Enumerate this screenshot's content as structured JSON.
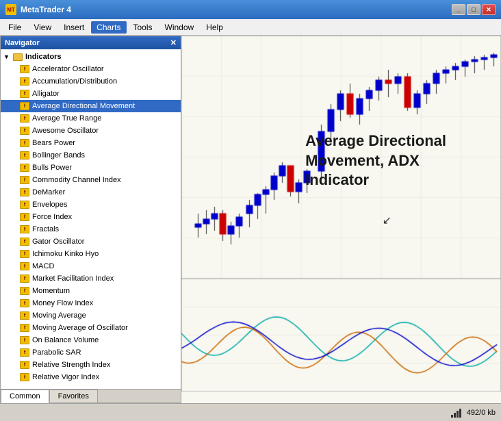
{
  "titleBar": {
    "title": "MetaTrader 4",
    "icon": "MT",
    "controls": [
      "_",
      "□",
      "×"
    ]
  },
  "menuBar": {
    "items": [
      "File",
      "View",
      "Insert",
      "Charts",
      "Tools",
      "Window",
      "Help"
    ],
    "active": "Charts"
  },
  "navigator": {
    "title": "Navigator",
    "sections": {
      "indicators": {
        "label": "Indicators",
        "expanded": true,
        "items": [
          "Accelerator Oscillator",
          "Accumulation/Distribution",
          "Alligator",
          "Average Directional Movement",
          "Average True Range",
          "Awesome Oscillator",
          "Bears Power",
          "Bollinger Bands",
          "Bulls Power",
          "Commodity Channel Index",
          "DeMarker",
          "Envelopes",
          "Force Index",
          "Fractals",
          "Gator Oscillator",
          "Ichimoku Kinko Hyo",
          "MACD",
          "Market Facilitation Index",
          "Momentum",
          "Money Flow Index",
          "Moving Average",
          "Moving Average of Oscillator",
          "On Balance Volume",
          "Parabolic SAR",
          "Relative Strength Index",
          "Relative Vigor Index"
        ]
      }
    },
    "tabs": [
      "Common",
      "Favorites"
    ]
  },
  "chart": {
    "adxLabel": {
      "line1": "Average Directional",
      "line2": "Movement, ADX",
      "line3": "Indicator"
    }
  },
  "statusBar": {
    "coords": "492/0 kb"
  }
}
